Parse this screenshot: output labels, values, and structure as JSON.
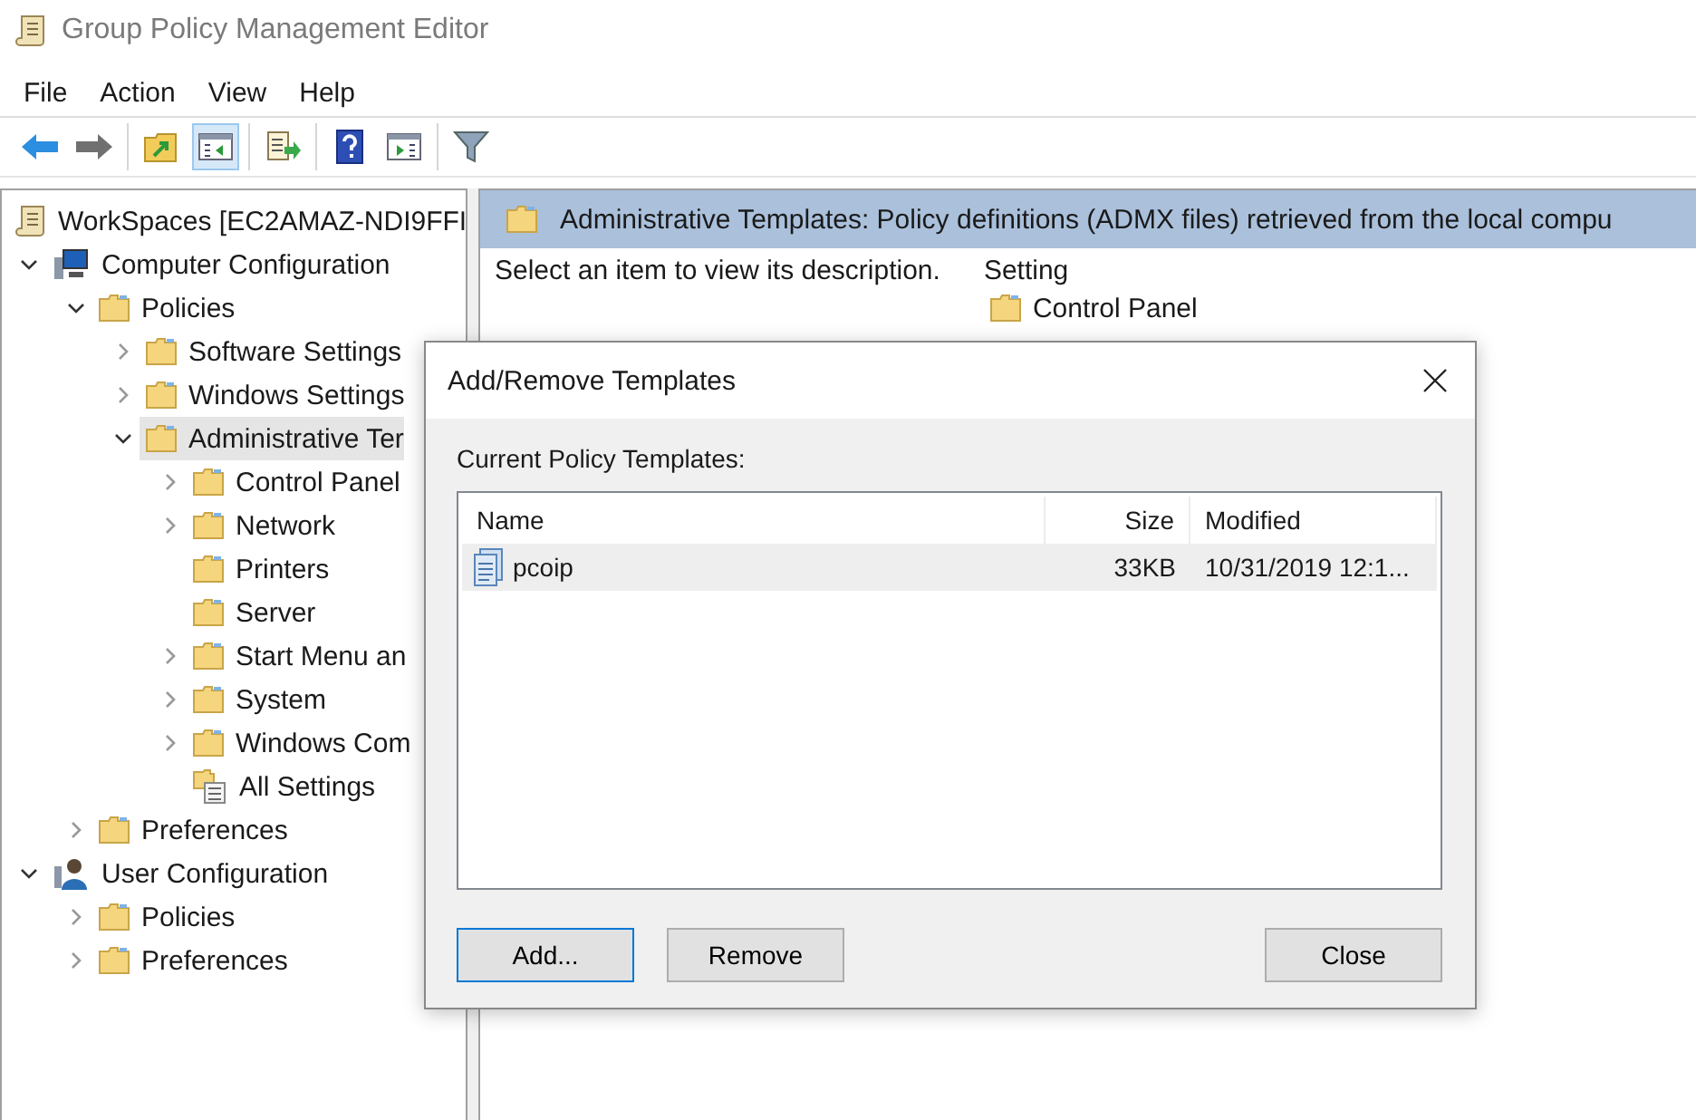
{
  "window": {
    "title": "Group Policy Management Editor"
  },
  "menu": [
    "File",
    "Action",
    "View",
    "Help"
  ],
  "toolbar": [
    [
      {
        "kind": "back",
        "pressed": false
      },
      {
        "kind": "forward",
        "pressed": false
      }
    ],
    [
      {
        "kind": "up",
        "pressed": false
      },
      {
        "kind": "tree",
        "pressed": true
      }
    ],
    [
      {
        "kind": "export",
        "pressed": false
      }
    ],
    [
      {
        "kind": "help",
        "pressed": false
      },
      {
        "kind": "pane",
        "pressed": false
      }
    ],
    [
      {
        "kind": "filter",
        "pressed": false
      }
    ]
  ],
  "tree": [
    {
      "label": "WorkSpaces [EC2AMAZ-NDI9FFI",
      "kind": "scroll",
      "selected": false,
      "children": [
        {
          "label": "Computer Configuration",
          "kind": "computer",
          "expanded": true,
          "selected": false,
          "children": [
            {
              "label": "Policies",
              "kind": "folder",
              "expanded": true,
              "selected": false,
              "children": [
                {
                  "label": "Software Settings",
                  "kind": "folder",
                  "expanded": false,
                  "selected": false
                },
                {
                  "label": "Windows Settings",
                  "kind": "folder",
                  "expanded": false,
                  "selected": false
                },
                {
                  "label": "Administrative Ter",
                  "kind": "folder",
                  "expanded": true,
                  "selected": true,
                  "children": [
                    {
                      "label": "Control Panel",
                      "kind": "folder",
                      "expanded": false,
                      "selected": false
                    },
                    {
                      "label": "Network",
                      "kind": "folder",
                      "expanded": false,
                      "selected": false
                    },
                    {
                      "label": "Printers",
                      "kind": "folder",
                      "selected": false
                    },
                    {
                      "label": "Server",
                      "kind": "folder",
                      "selected": false
                    },
                    {
                      "label": "Start Menu an",
                      "kind": "folder",
                      "expanded": false,
                      "selected": false
                    },
                    {
                      "label": "System",
                      "kind": "folder",
                      "expanded": false,
                      "selected": false
                    },
                    {
                      "label": "Windows Com",
                      "kind": "folder",
                      "expanded": false,
                      "selected": false
                    },
                    {
                      "label": "All Settings",
                      "kind": "settings",
                      "selected": false
                    }
                  ]
                }
              ]
            },
            {
              "label": "Preferences",
              "kind": "folder",
              "expanded": false,
              "selected": false
            }
          ]
        },
        {
          "label": "User Configuration",
          "kind": "user",
          "expanded": true,
          "selected": false,
          "children": [
            {
              "label": "Policies",
              "kind": "folder",
              "expanded": false,
              "selected": false
            },
            {
              "label": "Preferences",
              "kind": "folder",
              "expanded": false,
              "selected": false
            }
          ]
        }
      ]
    }
  ],
  "details": {
    "header": "Administrative Templates: Policy definitions (ADMX files) retrieved from the local compu",
    "description": "Select an item to view its description.",
    "column": "Setting",
    "items": [
      "Control Panel"
    ]
  },
  "dialog": {
    "title": "Add/Remove Templates",
    "label": "Current Policy Templates:",
    "columns": [
      "Name",
      "Size",
      "Modified"
    ],
    "rows": [
      {
        "name": "pcoip",
        "size": "33KB",
        "modified": "10/31/2019 12:1...",
        "selected": true
      }
    ],
    "buttons": [
      {
        "label": "Add...",
        "default": true
      },
      {
        "label": "Remove",
        "default": false
      },
      {
        "label": "Close",
        "default": false
      }
    ]
  }
}
